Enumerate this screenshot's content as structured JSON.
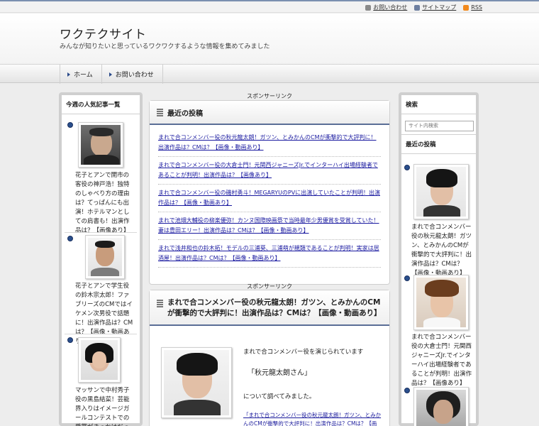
{
  "topbar": {
    "links": [
      {
        "label": "お問い合わせ",
        "icon": "mail-icon"
      },
      {
        "label": "サイトマップ",
        "icon": "sitemap-icon"
      },
      {
        "label": "RSS",
        "icon": "rss-icon"
      }
    ]
  },
  "header": {
    "title": "ワクテクサイト",
    "description": "みんなが知りたいと思っているワクワクするような情報を集めてみました"
  },
  "nav": {
    "items": [
      {
        "label": "ホーム"
      },
      {
        "label": "お問い合わせ"
      }
    ]
  },
  "left_sidebar": {
    "heading": "今週の人気記事一覧",
    "items": [
      {
        "text": "花子とアンで開市の客役の神戸浩！独特のしゃべり方の理由は？てっぱんにも出演！ホテルマンとしての肩書も！出演作品は？【画像あり】"
      },
      {
        "text": "花子とアンで学生役の鈴木宗太郎！ファブリーズのCMではイケメン次男役で話題に！出演作品は？CMは？【画像・動画あり】"
      },
      {
        "text": "マッサンで中村秀子役の黒島結菜！芸能界入りはイメージガールコンテストでの受賞がきっかけだった！出演作品は？"
      }
    ]
  },
  "main": {
    "sponsor_label_top": "スポンサーリンク",
    "recent_heading": "最近の投稿",
    "recent_posts": [
      "まれで合コンメンバー役の秋元龍太朗！ガツン、とみかんのCMが衝撃的で大評判に！出演作品は？CMは？【画像・動画あり】",
      "まれで合コンメンバー役の大倉士門！元関西ジャニーズJr.でインターハイ出場経験者であることが判明！出演作品は？【画像あり】",
      "まれで合コンメンバー役の磯村勇斗！MEGARYUのPVに出演していたことが判明！出演作品は？【画像・動画あり】",
      "まれで池畑大輔役の柳楽優弥！カンヌ国際映画祭で当時最年少男優賞を受賞していた！妻は豊田エリー！出演作品は？CMは？【画像・動画あり】",
      "まれで浅井和也の鈴木拓！モデルの三浦葵、三浦萌が親類であることが判明！実家は居酒屋！出演作品は？CMは？【画像・動画あり】"
    ],
    "sponsor_label_bottom": "スポンサーリンク",
    "article": {
      "title": "まれで合コンメンバー役の秋元龍太朗！ガツン、とみかんのCMが衝撃的で大評判に！出演作品は？CMは？【画像・動画あり】",
      "intro": "まれで合コンメンバー役を演じられています",
      "name_quote": "「秋元龍太朗さん」",
      "research_line": "について調べてみました。",
      "link_text": "「まれで合コンメンバー役の秋元龍太朗！ガツン、とみかんのCMが衝撃的で大評判に！出演作品は？CMは？【画像・動画あり】」"
    }
  },
  "right_sidebar": {
    "search_heading": "検索",
    "search_placeholder": "サイト内検索",
    "recent_heading": "最近の投稿",
    "items": [
      {
        "text": "まれで合コンメンバー役の秋元龍太朗！ガツン、とみかんのCMが衝撃的で大評判に！出演作品は？CMは？【画像・動画あり】"
      },
      {
        "text": "まれで合コンメンバー役の大倉士門！元関西ジャニーズJr.でインターハイ出場経験者であることが判明！出演作品は？【画像あり】"
      }
    ]
  },
  "colors": {
    "accent": "#5a6e96",
    "bullet": "#2a4f8c",
    "link": "#1a1aa0",
    "rss": "#f28a1e"
  }
}
